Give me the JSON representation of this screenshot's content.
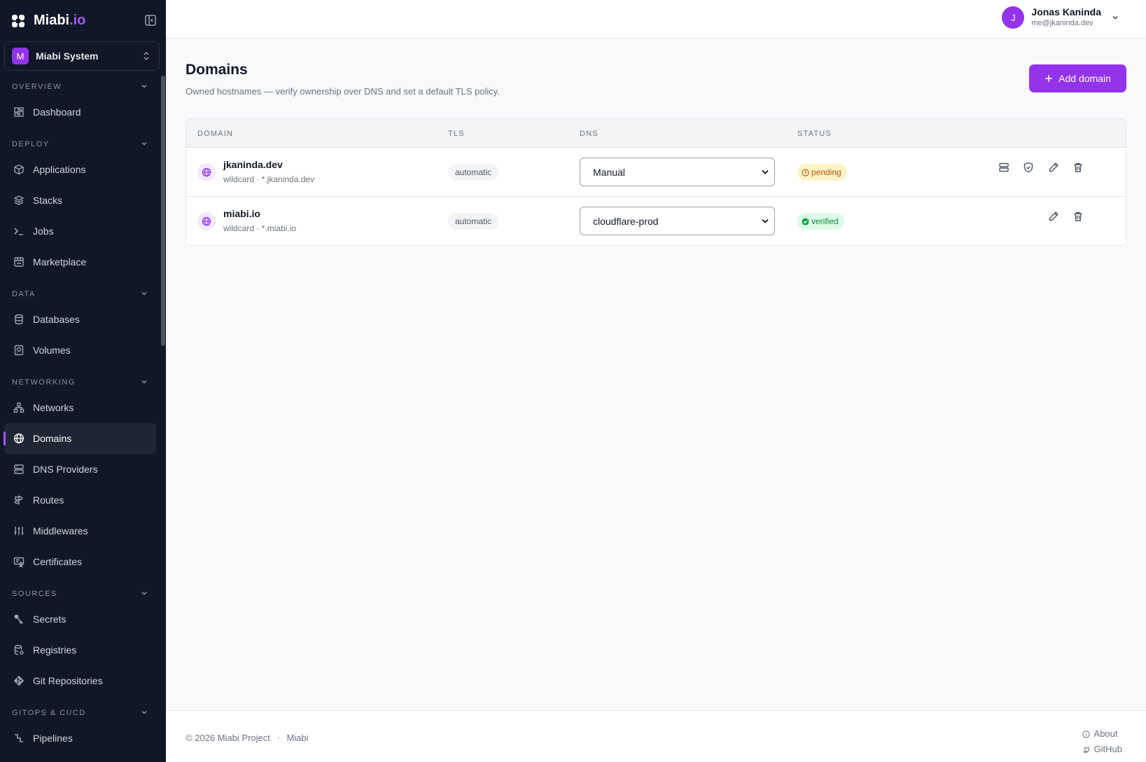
{
  "brand": {
    "name_main": "Miabi",
    "name_accent": ".io"
  },
  "org": {
    "initial": "M",
    "name": "Miabi System"
  },
  "nav": {
    "overview": "OVERVIEW",
    "dashboard": "Dashboard",
    "deploy": "DEPLOY",
    "applications": "Applications",
    "stacks": "Stacks",
    "jobs": "Jobs",
    "marketplace": "Marketplace",
    "data": "DATA",
    "databases": "Databases",
    "volumes": "Volumes",
    "networking": "NETWORKING",
    "networks": "Networks",
    "domains": "Domains",
    "dns_providers": "DNS Providers",
    "routes": "Routes",
    "middlewares": "Middlewares",
    "certificates": "Certificates",
    "sources": "SOURCES",
    "secrets": "Secrets",
    "registries": "Registries",
    "git_repositories": "Git Repositories",
    "gitops": "GITOPS & CI/CD",
    "pipelines": "Pipelines"
  },
  "user": {
    "initial": "J",
    "name": "Jonas Kaninda",
    "email": "me@jkaninda.dev"
  },
  "page": {
    "title": "Domains",
    "subtitle": "Owned hostnames — verify ownership over DNS and set a default TLS policy.",
    "add_button": "Add domain"
  },
  "table": {
    "headers": {
      "domain": "DOMAIN",
      "tls": "TLS",
      "dns": "DNS",
      "status": "STATUS"
    },
    "rows": [
      {
        "domain": "jkaninda.dev",
        "sub": "wildcard · *.jkaninda.dev",
        "tls": "automatic",
        "dns": "Manual",
        "status": "pending"
      },
      {
        "domain": "miabi.io",
        "sub": "wildcard · *.miabi.io",
        "tls": "automatic",
        "dns": "cloudflare-prod",
        "status": "verified"
      }
    ]
  },
  "footer": {
    "copyright": "© 2026 Miabi Project",
    "separator": "·",
    "product": "Miabi",
    "about": "About",
    "github": "GitHub"
  },
  "colors": {
    "accent": "#9333ea",
    "sidebar_bg": "#101827",
    "pending": "#b45309",
    "verified": "#15803d"
  }
}
